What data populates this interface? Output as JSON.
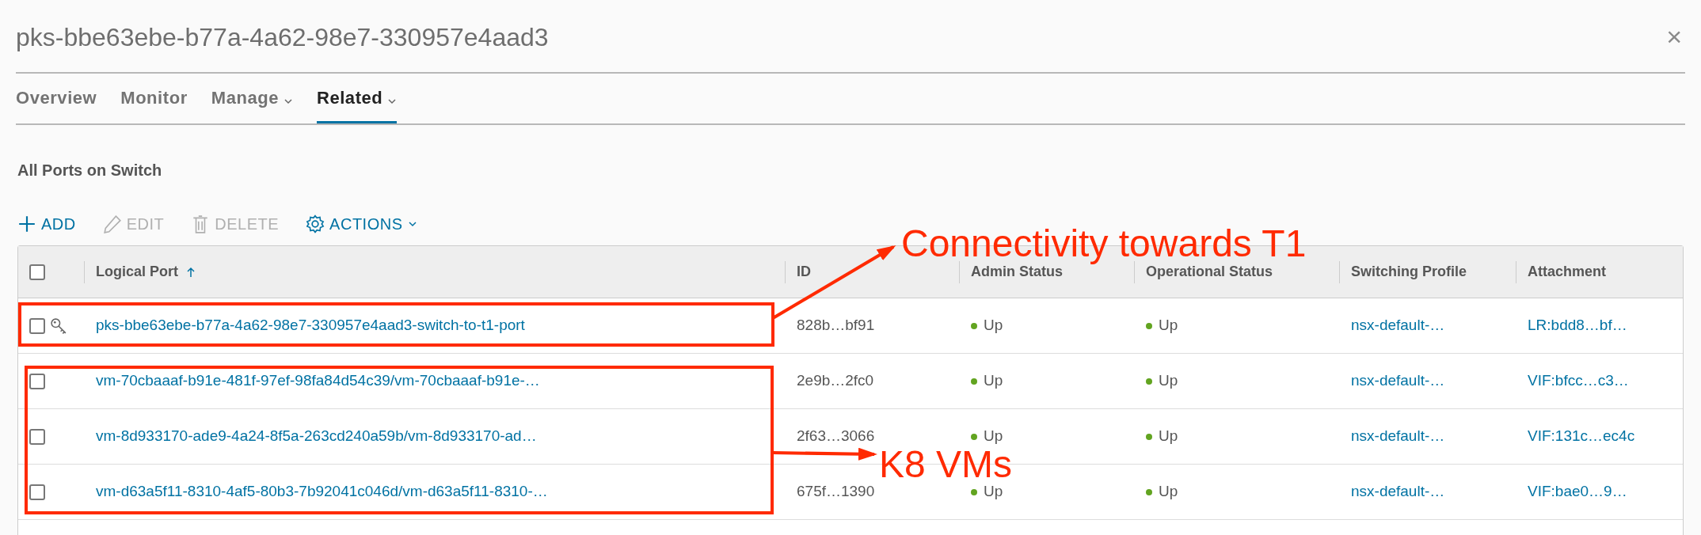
{
  "window": {
    "title": "pks-bbe63ebe-b77a-4a62-98e7-330957e4aad3",
    "close": "×"
  },
  "tabs": [
    {
      "label": "Overview",
      "selected": false,
      "dropdown": false
    },
    {
      "label": "Monitor",
      "selected": false,
      "dropdown": false
    },
    {
      "label": "Manage",
      "selected": false,
      "dropdown": true
    },
    {
      "label": "Related",
      "selected": true,
      "dropdown": true
    }
  ],
  "section_title": "All Ports on Switch",
  "toolbar": [
    {
      "kind": "add",
      "label": "ADD",
      "disabled": false
    },
    {
      "kind": "edit",
      "label": "EDIT",
      "disabled": true
    },
    {
      "kind": "delete",
      "label": "DELETE",
      "disabled": true
    },
    {
      "kind": "actions",
      "label": "ACTIONS",
      "disabled": false
    }
  ],
  "table": {
    "select_all_checked": false,
    "columns": [
      {
        "label": "Logical Port",
        "sorted": true
      },
      {
        "label": "ID",
        "sorted": false
      },
      {
        "label": "Admin Status",
        "sorted": false
      },
      {
        "label": "Operational Status",
        "sorted": false
      },
      {
        "label": "Switching Profile",
        "sorted": false
      },
      {
        "label": "Attachment",
        "sorted": false
      }
    ],
    "rows": [
      {
        "checked": false,
        "key_icon": true,
        "logical_port": "pks-bbe63ebe-b77a-4a62-98e7-330957e4aad3-switch-to-t1-port",
        "id": "828b…bf91",
        "admin_status": {
          "text": "Up",
          "color": "#62a420"
        },
        "operational_status": {
          "text": "Up",
          "color": "#62a420"
        },
        "switching_profile": "nsx-default-…",
        "attachment": "LR:bdd8…bf…"
      },
      {
        "checked": false,
        "key_icon": false,
        "logical_port": "vm-70cbaaaf-b91e-481f-97ef-98fa84d54c39/vm-70cbaaaf-b91e-…",
        "id": "2e9b…2fc0",
        "admin_status": {
          "text": "Up",
          "color": "#62a420"
        },
        "operational_status": {
          "text": "Up",
          "color": "#62a420"
        },
        "switching_profile": "nsx-default-…",
        "attachment": "VIF:bfcc…c3…"
      },
      {
        "checked": false,
        "key_icon": false,
        "logical_port": "vm-8d933170-ade9-4a24-8f5a-263cd240a59b/vm-8d933170-ad…",
        "id": "2f63…3066",
        "admin_status": {
          "text": "Up",
          "color": "#62a420"
        },
        "operational_status": {
          "text": "Up",
          "color": "#62a420"
        },
        "switching_profile": "nsx-default-…",
        "attachment": "VIF:131c…ec4c"
      },
      {
        "checked": false,
        "key_icon": false,
        "logical_port": "vm-d63a5f11-8310-4af5-80b3-7b92041c046d/vm-d63a5f11-8310-…",
        "id": "675f…1390",
        "admin_status": {
          "text": "Up",
          "color": "#62a420"
        },
        "operational_status": {
          "text": "Up",
          "color": "#62a420"
        },
        "switching_profile": "nsx-default-…",
        "attachment": "VIF:bae0…9…"
      }
    ]
  },
  "annotations": [
    {
      "text": "Connectivity towards T1"
    },
    {
      "text": "K8 VMs"
    }
  ]
}
